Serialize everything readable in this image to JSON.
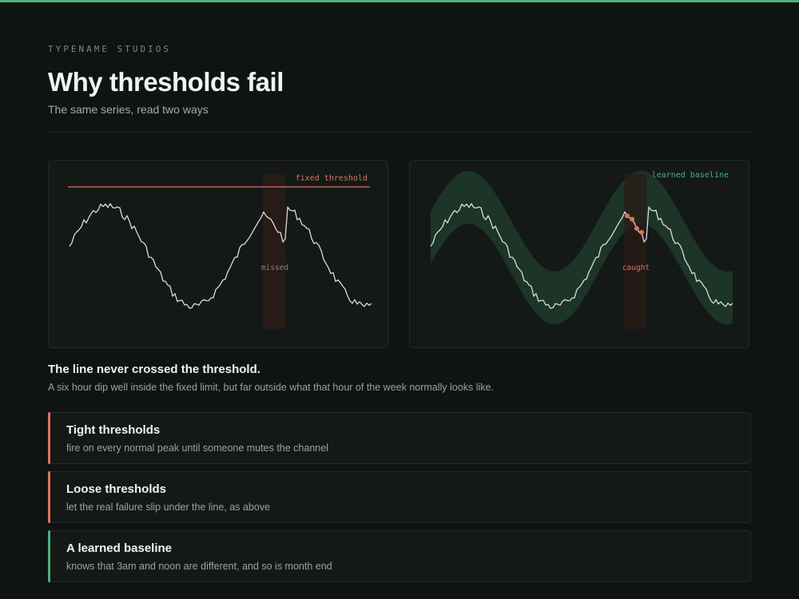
{
  "header": {
    "eyebrow": "TYPENAME STUDIOS",
    "title": "Why thresholds fail",
    "subtitle": "The same series, read two ways"
  },
  "colors": {
    "accent_green": "#4fae7e",
    "accent_red": "#d9765d",
    "background": "#0f1311",
    "panel": "#141917"
  },
  "left_panel": {
    "threshold_label": "fixed threshold",
    "anomaly_label": "missed"
  },
  "right_panel": {
    "baseline_label": "learned baseline",
    "anomaly_label": "caught"
  },
  "insight": {
    "title": "The line never crossed the threshold.",
    "body": "A six hour dip well inside the fixed limit, but far outside what that hour of the week normally looks like."
  },
  "cards": [
    {
      "title": "Tight thresholds",
      "body": "fire on every normal peak until someone mutes the channel",
      "accent": "#d9765d"
    },
    {
      "title": "Loose thresholds",
      "body": "let the real failure slip under the line, as above",
      "accent": "#d9765d"
    },
    {
      "title": "A learned baseline",
      "body": "knows that 3am and noon are different, and so is month end",
      "accent": "#4fae7e"
    }
  ]
}
